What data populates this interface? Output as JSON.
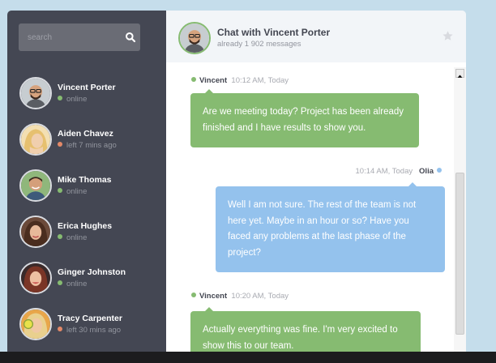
{
  "search": {
    "placeholder": "search"
  },
  "people": [
    {
      "name": "Vincent Porter",
      "status": "online",
      "status_color": "#86bb71"
    },
    {
      "name": "Aiden Chavez",
      "status": "left 7 mins ago",
      "status_color": "#e38968"
    },
    {
      "name": "Mike Thomas",
      "status": "online",
      "status_color": "#86bb71"
    },
    {
      "name": "Erica Hughes",
      "status": "online",
      "status_color": "#86bb71"
    },
    {
      "name": "Ginger Johnston",
      "status": "online",
      "status_color": "#86bb71"
    },
    {
      "name": "Tracy Carpenter",
      "status": "left 30 mins ago",
      "status_color": "#e38968"
    }
  ],
  "chat": {
    "title": "Chat with Vincent Porter",
    "count": "already 1 902 messages",
    "icons": {
      "star": "star-icon",
      "search": "search-icon"
    }
  },
  "messages": [
    {
      "sender": "Vincent",
      "time": "10:12 AM, Today",
      "side": "left",
      "color": "#86bb71",
      "text": "Are we meeting today? Project has been already finished and I have results to show you."
    },
    {
      "sender": "Olia",
      "time": "10:14 AM, Today",
      "side": "right",
      "color": "#94c2ed",
      "text": "Well I am not sure. The rest of the team is not here yet. Maybe in an hour or so? Have you faced any problems at the last phase of the project?"
    },
    {
      "sender": "Vincent",
      "time": "10:20 AM, Today",
      "side": "left",
      "color": "#86bb71",
      "text": "Actually everything was fine. I'm very excited to show this to our team."
    }
  ],
  "colors": {
    "sidebar": "#444753",
    "online": "#86bb71",
    "away": "#e38968",
    "page_bg": "#c5ddeb"
  }
}
